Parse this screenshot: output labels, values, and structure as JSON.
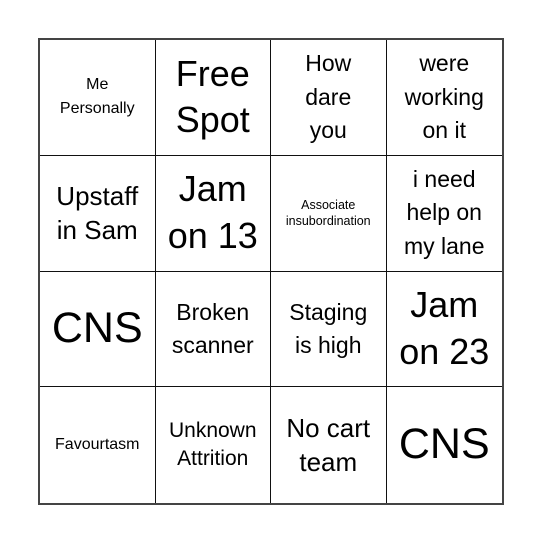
{
  "card": {
    "cells": [
      [
        "Me\nPersonally",
        "Free\nSpot",
        "How\ndare\nyou",
        "were\nworking\non it"
      ],
      [
        "Upstaff\nin Sam",
        "Jam\non 13",
        "Associate\ninsubordination",
        "i need\nhelp on\nmy lane"
      ],
      [
        "CNS",
        "Broken\nscanner",
        "Staging\nis high",
        "Jam\non 23"
      ],
      [
        "Favourtasm",
        "Unknown\nAttrition",
        "No cart\nteam",
        "CNS"
      ]
    ],
    "r0c0": {
      "l1": "Me",
      "l2": "Personally"
    },
    "r0c1": {
      "l1": "Free",
      "l2": "Spot"
    },
    "r0c2": {
      "l1": "How",
      "l2": "dare",
      "l3": "you"
    },
    "r0c3": {
      "l1": "were",
      "l2": "working",
      "l3": "on it"
    },
    "r1c0": {
      "l1": "Upstaff",
      "l2": "in Sam"
    },
    "r1c1": {
      "l1": "Jam",
      "l2": "on 13"
    },
    "r1c2": {
      "l1": "Associate",
      "l2": "insubordination"
    },
    "r1c3": {
      "l1": "i need",
      "l2": "help on",
      "l3": "my lane"
    },
    "r2c0": {
      "l1": "CNS"
    },
    "r2c1": {
      "l1": "Broken",
      "l2": "scanner"
    },
    "r2c2": {
      "l1": "Staging",
      "l2": "is high"
    },
    "r2c3": {
      "l1": "Jam",
      "l2": "on 23"
    },
    "r3c0": {
      "l1": "Favourtasm"
    },
    "r3c1": {
      "l1": "Unknown",
      "l2": "Attrition"
    },
    "r3c2": {
      "l1": "No cart",
      "l2": "team"
    },
    "r3c3": {
      "l1": "CNS"
    }
  }
}
